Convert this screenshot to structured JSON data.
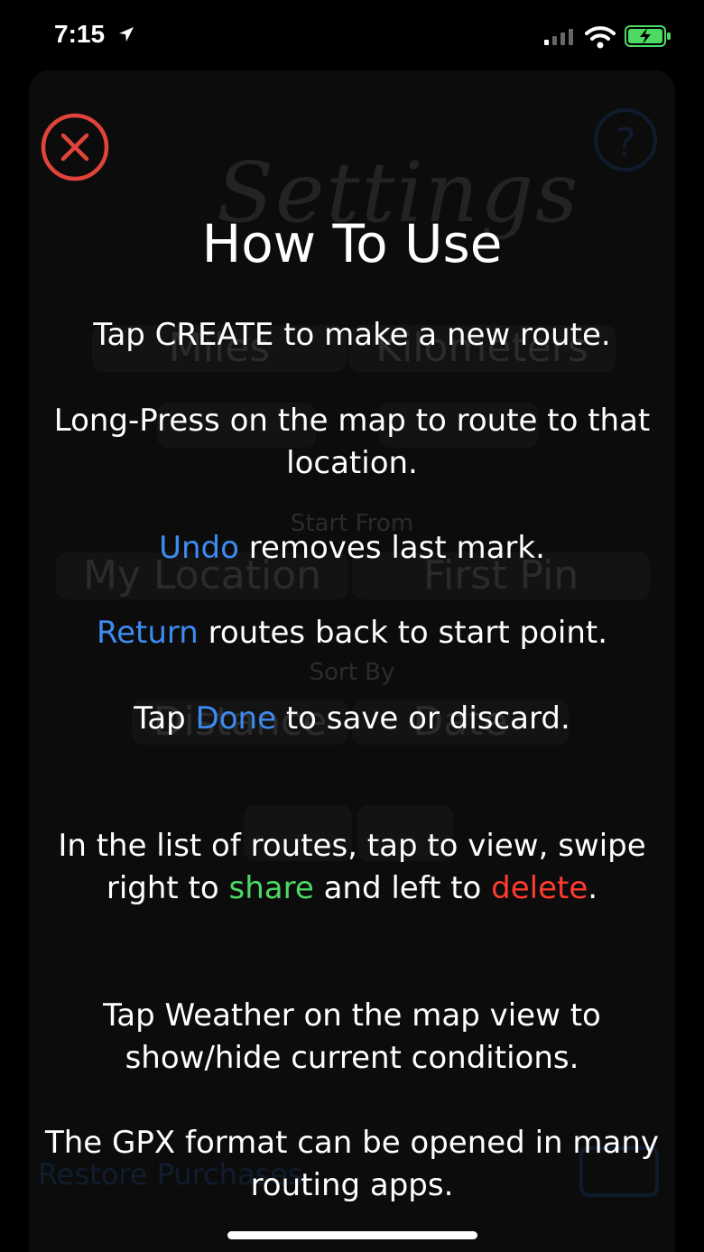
{
  "status_bar": {
    "time": "7:15"
  },
  "background": {
    "title": "Settings",
    "units": [
      "Miles",
      "Kilometers"
    ],
    "start_from_label": "Start From",
    "start_from": [
      "My Location",
      "First Pin"
    ],
    "sort_label": "Sort By",
    "sort": [
      "Distance",
      "Date"
    ],
    "restore_label": "Restore Purchases"
  },
  "overlay": {
    "title": "How To Use",
    "p1": "Tap CREATE to make a new route.",
    "p2": "Long-Press on the map to route to that location.",
    "p3": {
      "highlight": "Undo",
      "rest": " removes last mark."
    },
    "p4": {
      "highlight": "Return",
      "rest": " routes back to start point."
    },
    "p5": {
      "pre": "Tap ",
      "highlight": "Done",
      "rest": " to save or discard."
    },
    "p6": {
      "pre": "In the list of routes, tap to view, swipe right to ",
      "share": "share",
      "mid": " and left to ",
      "delete": "delete",
      "end": "."
    },
    "p7": "Tap Weather on the map view to show/hide current conditions.",
    "p8": "The GPX format can be opened in many routing apps."
  },
  "colors": {
    "accent_blue": "#3d8bf0",
    "share_green": "#4cd964",
    "delete_red": "#ff3b30",
    "close_red": "#e0443a"
  }
}
